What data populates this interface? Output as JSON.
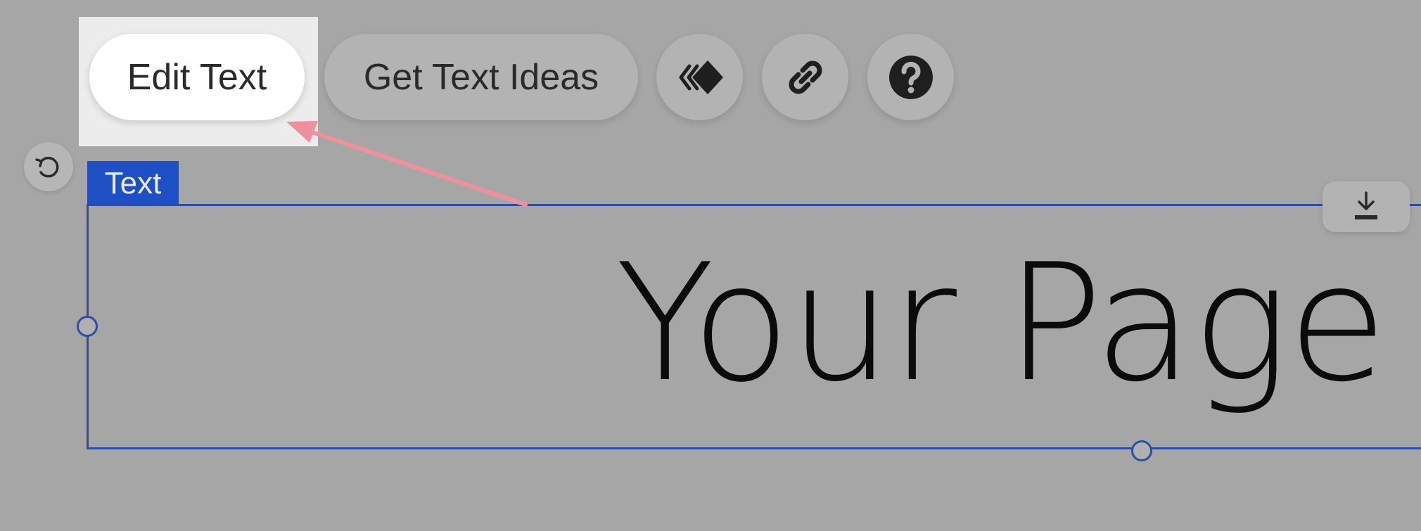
{
  "toolbar": {
    "edit_text_label": "Edit Text",
    "get_text_ideas_label": "Get Text Ideas",
    "icons": [
      "animation-icon",
      "link-icon",
      "help-icon"
    ]
  },
  "element": {
    "tag_label": "Text",
    "content": "Your Page"
  },
  "colors": {
    "canvas_bg": "#a6a6a6",
    "selection_blue": "#2b4ea6",
    "tag_blue": "#1f4fc4",
    "annotation_arrow": "#f0909e"
  }
}
